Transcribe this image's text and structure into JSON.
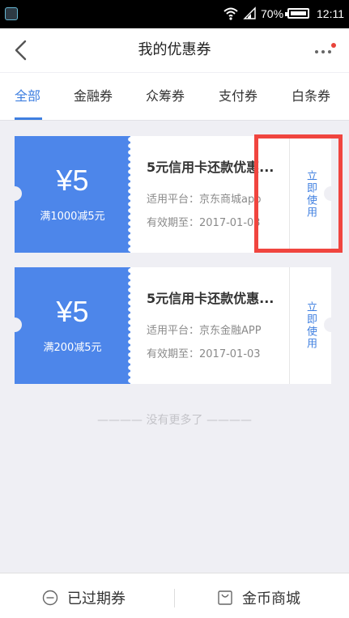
{
  "status_bar": {
    "battery_percent": "70%",
    "time": "12:11"
  },
  "header": {
    "title": "我的优惠券"
  },
  "tabs": [
    {
      "label": "全部",
      "active": true
    },
    {
      "label": "金融券",
      "active": false
    },
    {
      "label": "众筹券",
      "active": false
    },
    {
      "label": "支付券",
      "active": false
    },
    {
      "label": "白条券",
      "active": false
    }
  ],
  "coupons": [
    {
      "amount": "¥5",
      "condition": "满1000减5元",
      "title": "5元信用卡还款优惠...",
      "platform": "适用平台：京东商城app",
      "expiry": "有效期至：2017-01-03",
      "action": "立即使用"
    },
    {
      "amount": "¥5",
      "condition": "满200减5元",
      "title": "5元信用卡还款优惠...",
      "platform": "适用平台：京东金融APP",
      "expiry": "有效期至：2017-01-03",
      "action": "立即使用"
    }
  ],
  "list_end_text": "———— 没有更多了 ————",
  "bottom_bar": {
    "expired_label": "已过期券",
    "mall_label": "金币商城"
  },
  "colors": {
    "accent": "#3f7fe0",
    "coupon_blue": "#4d86ea",
    "highlight": "#f0453f",
    "notification_dot": "#e8443a"
  }
}
